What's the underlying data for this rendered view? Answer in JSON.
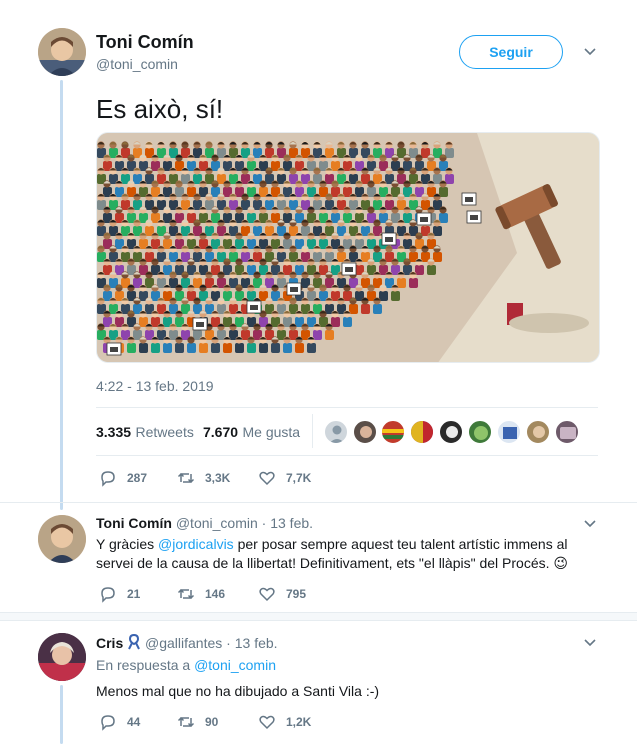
{
  "main_tweet": {
    "author_name": "Toni Comín",
    "author_handle": "@toni_comin",
    "follow_label": "Seguir",
    "text": "Es això, sí!",
    "timestamp": "4:22 - 13 feb. 2019",
    "retweets_count": "3.335",
    "retweets_label": "Retweets",
    "likes_count": "7.670",
    "likes_label": "Me gusta",
    "replies": "287",
    "retweets_short": "3,3K",
    "likes_short": "7,7K"
  },
  "reply1": {
    "author_name": "Toni Comín",
    "author_handle": "@toni_comin",
    "separator": "·",
    "date": "13 feb.",
    "text_before": "Y gràcies ",
    "mention": "@jordicalvis",
    "text_after": " per posar sempre aquest teu talent artístic immens al servei de la causa de la llibertat! Definitivament, ets \"el llàpis\" del Procés. ",
    "emoji": "😉",
    "replies": "21",
    "retweets": "146",
    "likes": "795"
  },
  "reply2": {
    "author_name": "Cris",
    "author_handle": "@gallifantes",
    "separator": "·",
    "date": "13 feb.",
    "in_reply_prefix": "En respuesta a ",
    "in_reply_handle": "@toni_comin",
    "text": "Menos mal que no ha dibujado a Santi Vila :-)",
    "replies": "44",
    "retweets": "90",
    "likes": "1,2K"
  },
  "colors": {
    "accent": "#1da1f2",
    "secondary_text": "#657786",
    "like_heart": "#657786"
  }
}
